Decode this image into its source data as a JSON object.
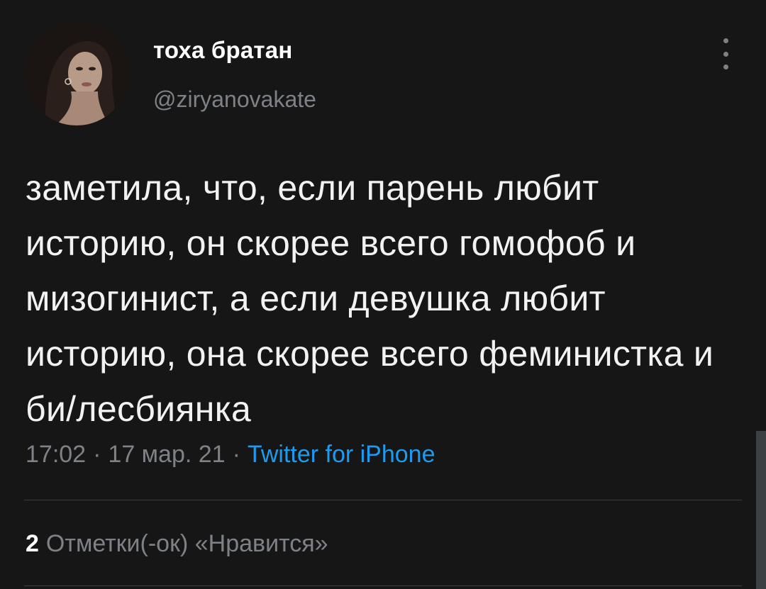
{
  "author": {
    "display_name": "тоха братан",
    "handle": "@ziryanovakate",
    "avatar_icon": "profile-photo"
  },
  "tweet": {
    "text": "заметила, что, если парень любит историю, он скорее всего гомофоб и мизогинист, а если девушка любит историю, она скорее всего феминистка и би/лесбиянка",
    "time": "17:02",
    "date": "17 мар. 21",
    "separator": "·",
    "source": "Twitter for iPhone"
  },
  "engagement": {
    "likes_count": "2",
    "likes_label": "Отметки(-ок) «Нравится»"
  },
  "colors": {
    "background": "#161616",
    "text": "#f2f2f2",
    "secondary": "#7e8287",
    "link": "#1d9bf0"
  }
}
